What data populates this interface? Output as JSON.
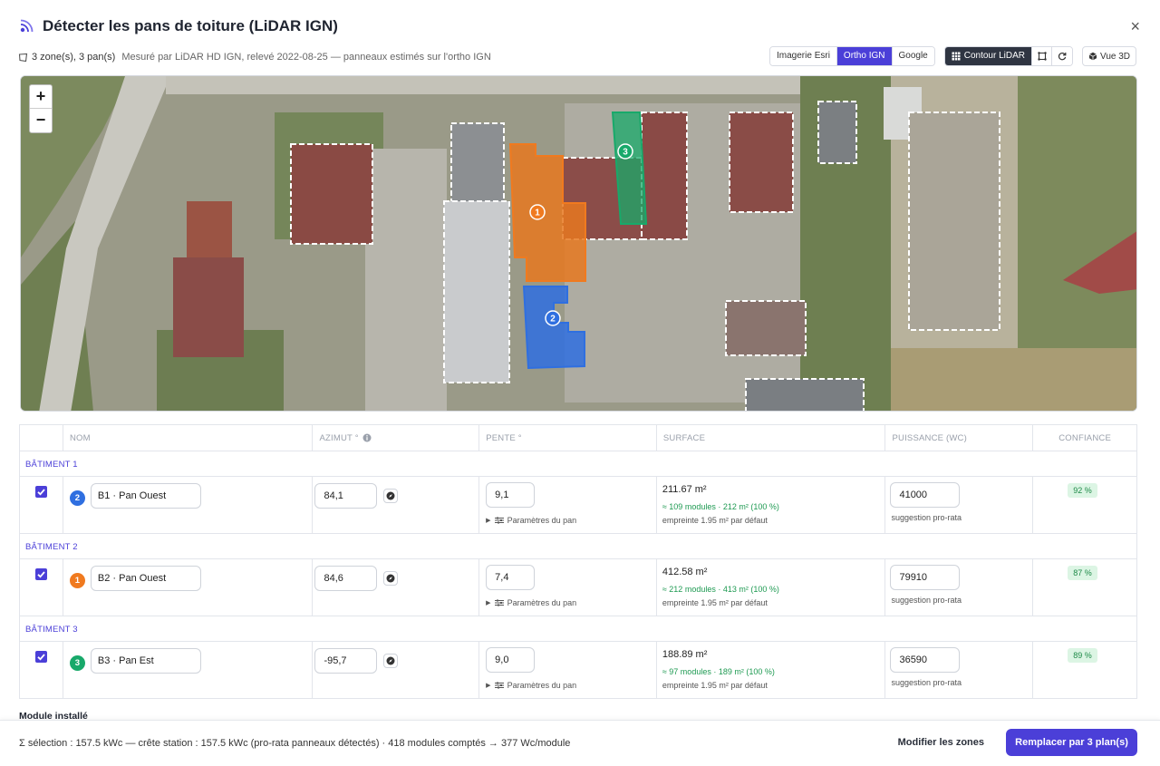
{
  "header": {
    "title": "Détecter les pans de toiture (LiDAR IGN)",
    "close": "×"
  },
  "subbar": {
    "zones": "3 zone(s), 3 pan(s)",
    "meta": "Mesuré par LiDAR HD IGN, relevé 2022-08-25 — panneaux estimés sur l'ortho IGN"
  },
  "toolbar": {
    "imagery": [
      "Imagerie Esri",
      "Ortho IGN",
      "Google"
    ],
    "imagery_active": "Ortho IGN",
    "contour": "Contour LiDAR",
    "view3d": "Vue 3D"
  },
  "map": {
    "zoom_in": "+",
    "zoom_out": "−",
    "markers": [
      "1",
      "2",
      "3"
    ],
    "colors": {
      "zone1": "#f07a1f",
      "zone2": "#2f6fe0",
      "zone3": "#18a96a"
    }
  },
  "table": {
    "columns": [
      "Nom",
      "Azimut °",
      "Pente °",
      "Surface",
      "Puissance (Wc)",
      "Confiance"
    ],
    "rows": [
      {
        "group": "Bâtiment 1",
        "badge": "2",
        "badge_color": "#2f6fe0",
        "name": "B1 · Pan Ouest",
        "azimut": "84,1",
        "pente": "9,1",
        "params": "Paramètres du pan",
        "surface": "211.67 m²",
        "modules": "≈ 109 modules · 212 m² (100 %)",
        "footprint": "empreinte 1.95 m² par défaut",
        "power": "41000",
        "power_hint": "suggestion pro-rata",
        "confidence": "92 %"
      },
      {
        "group": "Bâtiment 2",
        "badge": "1",
        "badge_color": "#f07a1f",
        "name": "B2 · Pan Ouest",
        "azimut": "84,6",
        "pente": "7,4",
        "params": "Paramètres du pan",
        "surface": "412.58 m²",
        "modules": "≈ 212 modules · 413 m² (100 %)",
        "footprint": "empreinte 1.95 m² par défaut",
        "power": "79910",
        "power_hint": "suggestion pro-rata",
        "confidence": "87 %"
      },
      {
        "group": "Bâtiment 3",
        "badge": "3",
        "badge_color": "#18a96a",
        "name": "B3 · Pan Est",
        "azimut": "-95,7",
        "pente": "9,0",
        "params": "Paramètres du pan",
        "surface": "188.89 m²",
        "modules": "≈ 97 modules · 189 m² (100 %)",
        "footprint": "empreinte 1.95 m² par défaut",
        "power": "36590",
        "power_hint": "suggestion pro-rata",
        "confidence": "89 %"
      }
    ]
  },
  "section_label": "Module installé",
  "footer": {
    "summary": "Σ sélection : 157.5 kWc — crête station : 157.5 kWc (pro-rata panneaux détectés) · 418 modules comptés → 377 Wc/module",
    "modify": "Modifier les zones",
    "replace": "Remplacer par 3 plan(s)"
  },
  "accent": "#4b3fd8"
}
